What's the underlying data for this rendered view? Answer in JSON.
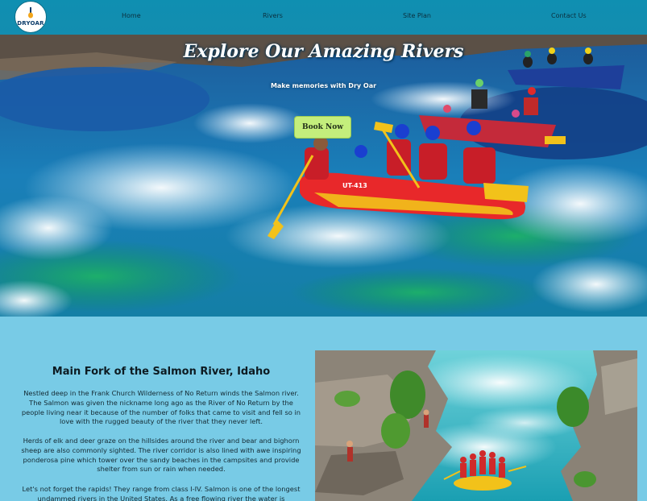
{
  "nav": {
    "logo_text": "DRYOAR",
    "links": [
      "Home",
      "Rivers",
      "Site Plan",
      "Contact Us"
    ]
  },
  "hero": {
    "title": "Explore Our Amazing Rivers",
    "subtitle": "Make memories with Dry Oar",
    "button_label": "Book Now",
    "raft_number": "UT-413"
  },
  "section": {
    "title": "Main Fork of the Salmon River, Idaho",
    "paragraphs": [
      "Nestled deep in the Frank Church Wilderness of No Return winds the Salmon river. The Salmon was given the nickname long ago as the River of No Return by the people living near it because of the number of folks that came to visit and fell so in love with the rugged beauty of the river that they never left.",
      "Herds of elk and deer graze on the hillsides around the river and bear and bighorn sheep are also commonly sighted. The river corridor is also lined with awe inspiring ponderosa pine which tower over the sandy beaches in the campsites and provide shelter from sun or rain when needed.",
      "Let's not forget the rapids! They range from class I-IV. Salmon is one of the longest undammed rivers in the United States. As a free flowing river the water is"
    ]
  },
  "colors": {
    "nav_bg": "#0f8fb1",
    "page_bg": "#78cbe6",
    "button_bg": "#c4ee7c"
  }
}
